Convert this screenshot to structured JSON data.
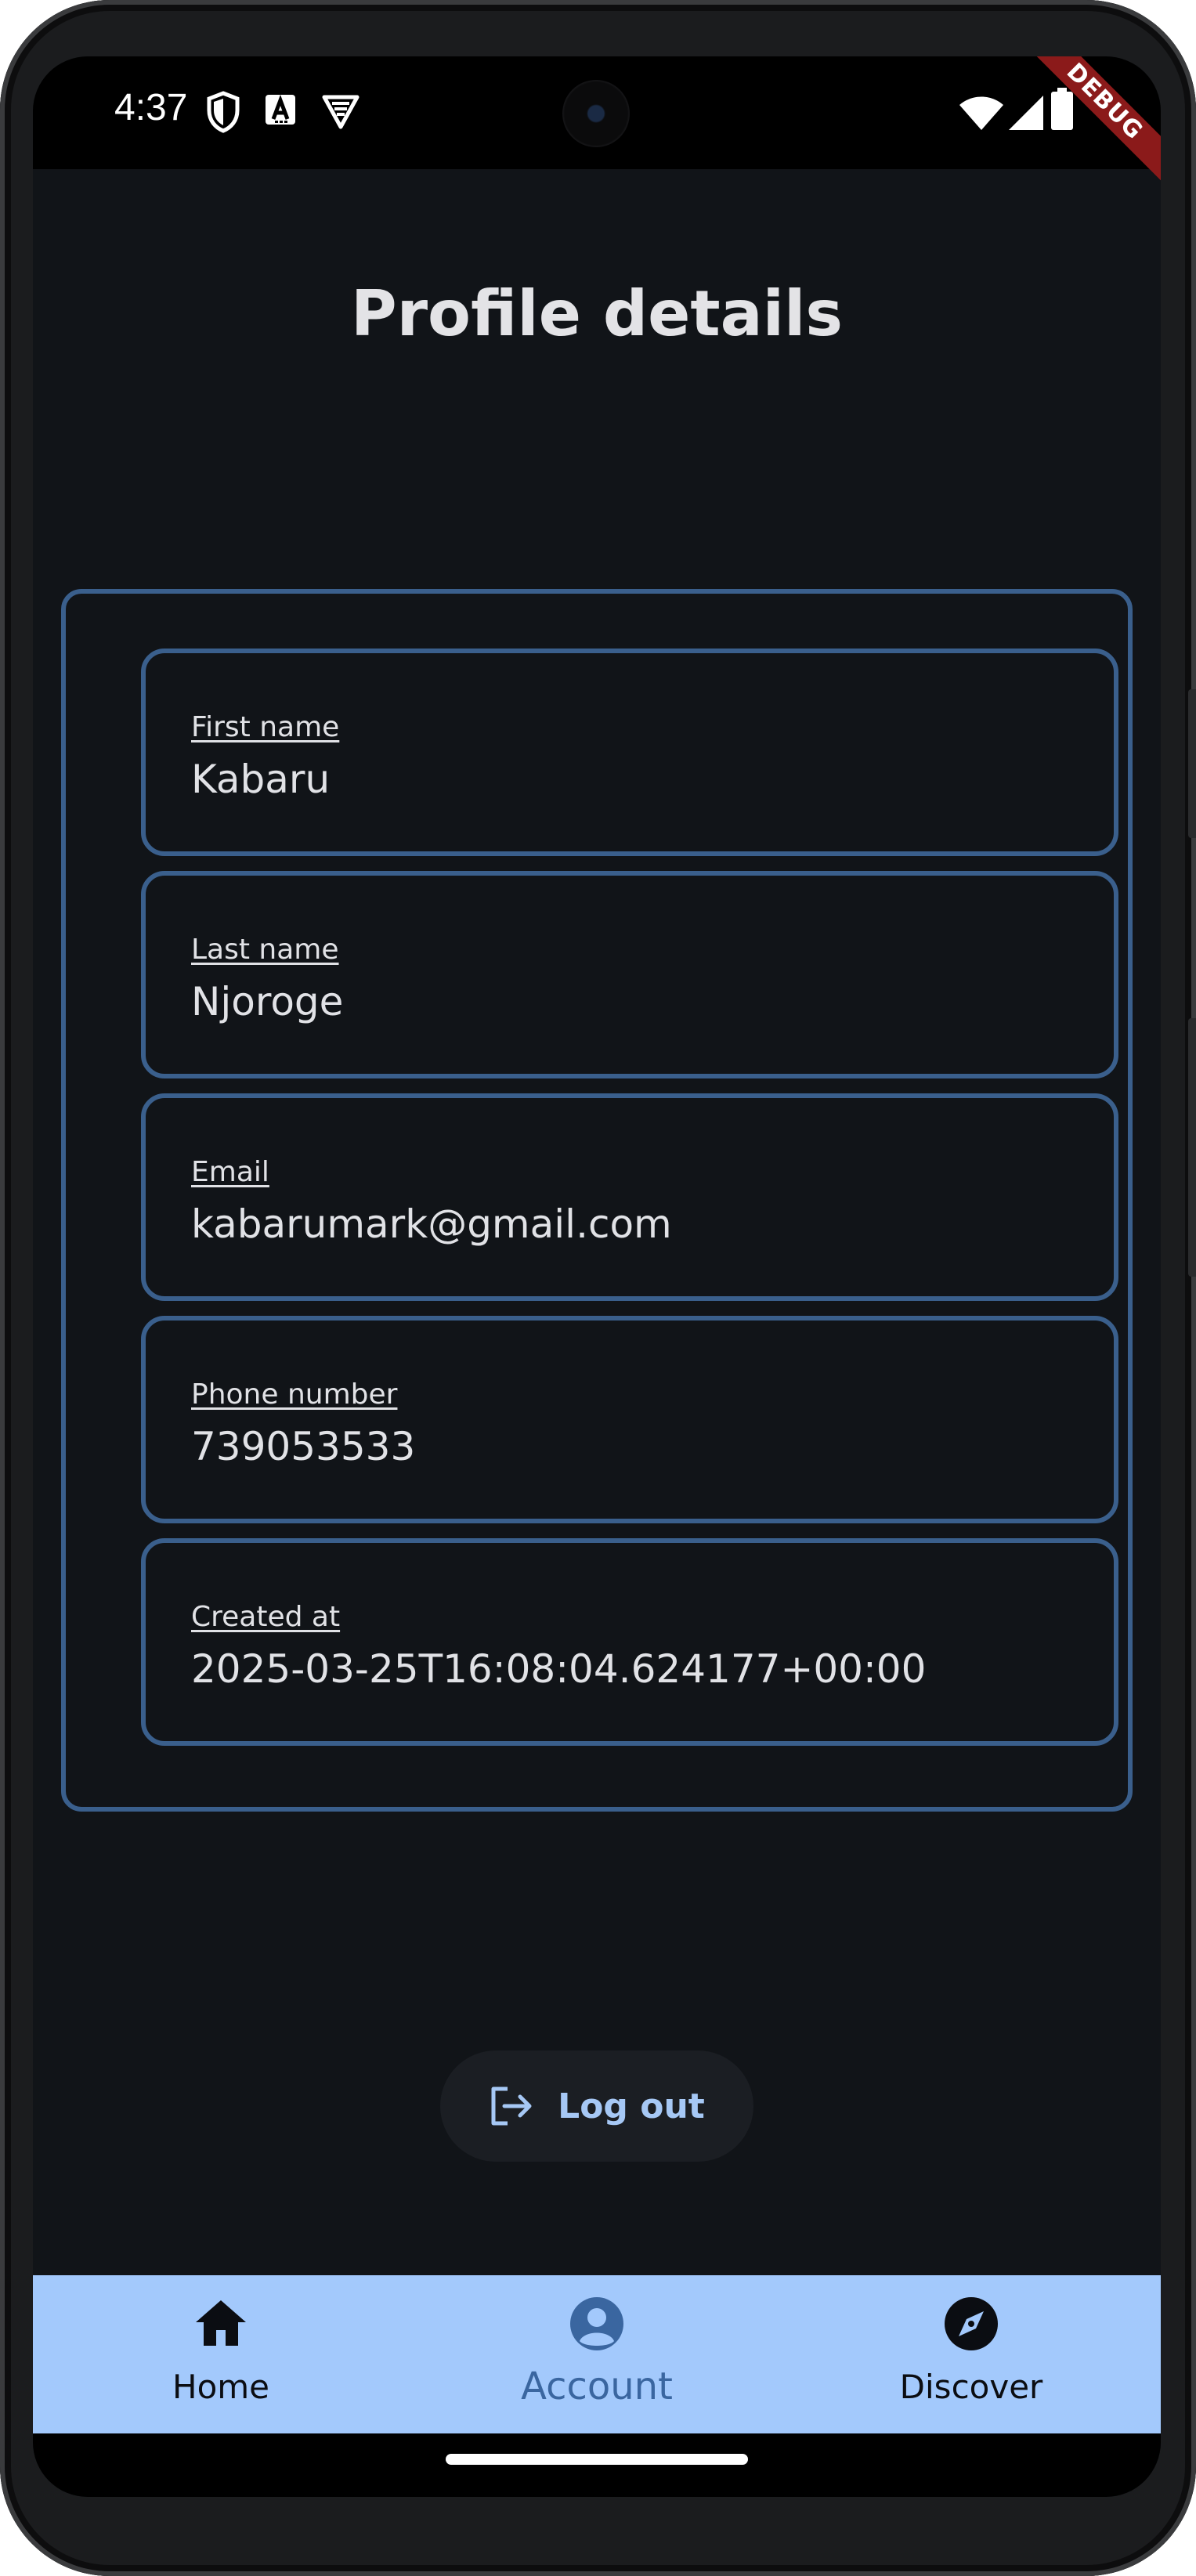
{
  "status_bar": {
    "time": "4:37",
    "debug_label": "DEBUG",
    "icons": [
      "shield-icon",
      "keyboard-a-icon",
      "vpn-shield-icon",
      "wifi-icon",
      "signal-icon",
      "battery-icon"
    ]
  },
  "page": {
    "title": "Profile details"
  },
  "profile": {
    "fields": [
      {
        "label": "First name",
        "value": "Kabaru"
      },
      {
        "label": "Last name",
        "value": "Njoroge"
      },
      {
        "label": "Email",
        "value": "kabarumark@gmail.com"
      },
      {
        "label": "Phone number",
        "value": "739053533"
      },
      {
        "label": "Created at",
        "value": "2025-03-25T16:08:04.624177+00:00"
      }
    ]
  },
  "actions": {
    "logout_label": "Log out"
  },
  "bottom_nav": {
    "items": [
      {
        "label": "Home",
        "icon": "home-icon",
        "active": false
      },
      {
        "label": "Account",
        "icon": "account-icon",
        "active": true
      },
      {
        "label": "Discover",
        "icon": "compass-icon",
        "active": false
      }
    ]
  },
  "colors": {
    "background": "#111418",
    "border_accent": "#3a5f8c",
    "nav_background": "#a3c9fc",
    "active_nav": "#3a66a0",
    "button_text": "#a6c8f5",
    "debug_banner": "#8b1a1a"
  }
}
